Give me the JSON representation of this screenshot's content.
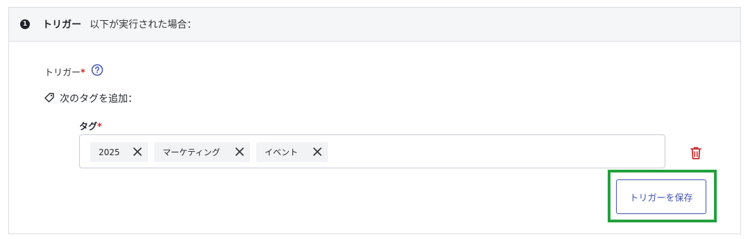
{
  "step": {
    "number": "1",
    "title": "トリガー",
    "subtitle": "以下が実行された場合："
  },
  "trigger_field": {
    "label": "トリガー",
    "required_mark": "*",
    "help_icon": "help-circle-icon"
  },
  "action": {
    "icon": "tag-icon",
    "label": "次のタグを追加："
  },
  "tags_field": {
    "label": "タグ",
    "required_mark": "*",
    "tags": [
      {
        "label": "2025"
      },
      {
        "label": "マーケティング"
      },
      {
        "label": "イベント"
      }
    ],
    "delete_icon": "trash-icon"
  },
  "save_button": {
    "label": "トリガーを保存"
  },
  "colors": {
    "accent": "#3f51b5",
    "danger": "#c62828",
    "highlight": "#22a03c",
    "header_bg": "#f5f6f8",
    "chip_bg": "#f2f3f5"
  }
}
